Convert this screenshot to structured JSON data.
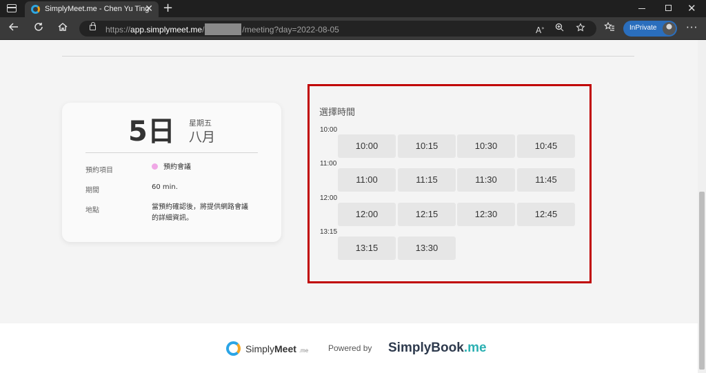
{
  "browser": {
    "tab_title": "SimplyMeet.me - Chen Yu Ting",
    "tab_close": "✕",
    "new_tab": "+",
    "url_scheme": "https://",
    "url_host": "app.simplymeet.me",
    "url_sep": "/",
    "url_path": "/meeting?day=2022-08-05",
    "inprivate_label": "InPrivate",
    "window_close": "✕"
  },
  "booking": {
    "day": "5日",
    "weekday": "星期五",
    "month": "八月",
    "details": [
      {
        "label": "預約項目",
        "value": "預約會議"
      },
      {
        "label": "期間",
        "value": "60 min."
      },
      {
        "label": "地點",
        "value_line1": "當預約確認後，將提供網路會議",
        "value_line2": "的詳細資訊。"
      }
    ]
  },
  "time_picker": {
    "title": "選擇時間",
    "groups": [
      {
        "hour": "10:00",
        "slots": [
          "10:00",
          "10:15",
          "10:30",
          "10:45"
        ]
      },
      {
        "hour": "11:00",
        "slots": [
          "11:00",
          "11:15",
          "11:30",
          "11:45"
        ]
      },
      {
        "hour": "12:00",
        "slots": [
          "12:00",
          "12:15",
          "12:30",
          "12:45"
        ]
      },
      {
        "hour": "13:15",
        "slots": [
          "13:15",
          "13:30"
        ]
      }
    ]
  },
  "footer": {
    "simplymeet_light": "Simply",
    "simplymeet_bold": "Meet",
    "simplymeet_suffix": ".me",
    "powered_by": "Powered by",
    "simplybook_main": "SimplyBook",
    "simplybook_suffix": ".me"
  },
  "colors": {
    "highlight_border": "#c00000",
    "slot_bg": "#e6e6e6",
    "inprivate": "#2a6ebd",
    "pink_dot": "#f0a8e6"
  }
}
